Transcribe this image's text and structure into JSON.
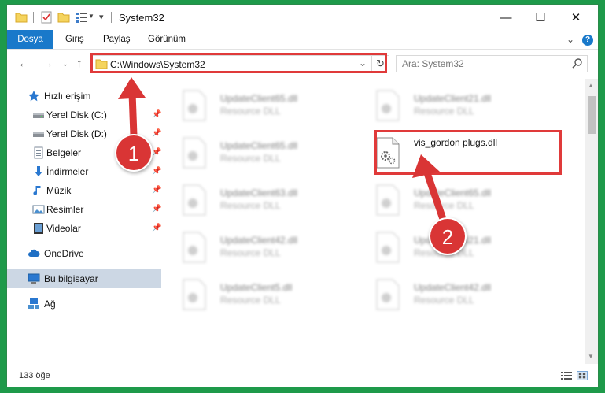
{
  "window": {
    "title": "System32",
    "controls": {
      "minimize": "—",
      "maximize": "☐",
      "close": "✕"
    }
  },
  "ribbon": {
    "tabs": [
      "Dosya",
      "Giriş",
      "Paylaş",
      "Görünüm"
    ]
  },
  "address": {
    "path": "C:\\Windows\\System32",
    "search_placeholder": "Ara: System32"
  },
  "nav_pane": {
    "quick_access": "Hızlı erişim",
    "items": [
      {
        "label": "Yerel Disk (C:)",
        "icon": "drive-icon",
        "pinned": true
      },
      {
        "label": "Yerel Disk (D:)",
        "icon": "drive-icon",
        "pinned": true
      },
      {
        "label": "Belgeler",
        "icon": "documents-icon",
        "pinned": true
      },
      {
        "label": "İndirmeler",
        "icon": "download-icon",
        "pinned": true
      },
      {
        "label": "Müzik",
        "icon": "music-icon",
        "pinned": true
      },
      {
        "label": "Resimler",
        "icon": "pictures-icon",
        "pinned": true
      },
      {
        "label": "Videolar",
        "icon": "videos-icon",
        "pinned": true
      }
    ],
    "onedrive": "OneDrive",
    "this_pc": "Bu bilgisayar",
    "network": "Ağ"
  },
  "files": [
    {
      "name": "UpdateClient65.dll",
      "type": "Resource DLL"
    },
    {
      "name": "UpdateClient21.dll",
      "type": "Resource DLL"
    },
    {
      "name": "UpdateClient65.dll",
      "type": "Resource DLL"
    },
    {
      "name": "vis_gordon plugs.dll",
      "type": ""
    },
    {
      "name": "UpdateClient63.dll",
      "type": "Resource DLL"
    },
    {
      "name": "UpdateClient65.dll",
      "type": "Resource DLL"
    },
    {
      "name": "UpdateClient42.dll",
      "type": "Resource DLL"
    },
    {
      "name": "UpdateClient21.dll",
      "type": "Resource DLL"
    },
    {
      "name": "UpdateClient5.dll",
      "type": "Resource DLL"
    },
    {
      "name": "UpdateClient42.dll",
      "type": "Resource DLL"
    }
  ],
  "status": {
    "count": "133 öğe"
  },
  "annotations": {
    "step1": "1",
    "step2": "2"
  },
  "colors": {
    "accent": "#1979ca",
    "highlight": "#e03a3a",
    "background": "#1e9a4a",
    "selected": "#ccd7e4"
  }
}
